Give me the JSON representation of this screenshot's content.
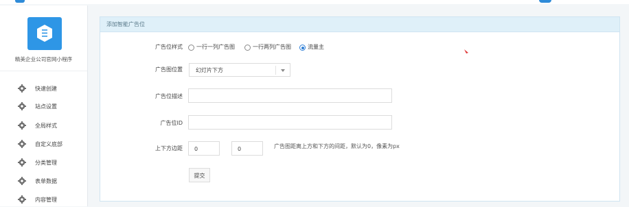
{
  "colors": {
    "accent": "#2e96e6",
    "panel_header_bg": "#dff0f9",
    "radio_checked": "#2f7fd6"
  },
  "sidebar": {
    "logo_icon": "hexagon-logo-icon",
    "app_name": "精美企业公司官网小程序",
    "items": [
      {
        "label": "快速创建",
        "icon": "gear-icon"
      },
      {
        "label": "站点设置",
        "icon": "gear-icon"
      },
      {
        "label": "全局样式",
        "icon": "gear-icon"
      },
      {
        "label": "自定义底部",
        "icon": "gear-icon"
      },
      {
        "label": "分类管理",
        "icon": "gear-icon"
      },
      {
        "label": "表单数据",
        "icon": "gear-icon"
      },
      {
        "label": "内容管理",
        "icon": "gear-icon"
      }
    ]
  },
  "panel": {
    "title": "添加智能广告位"
  },
  "form": {
    "style_label": "广告位样式",
    "style_options": [
      {
        "label": "一行一列广告图",
        "checked": false
      },
      {
        "label": "一行两列广告图",
        "checked": false
      },
      {
        "label": "流量主",
        "checked": true
      }
    ],
    "position_label": "广告图位置",
    "position_value": "幻灯片下方",
    "description_label": "广告位描述",
    "description_value": "",
    "adid_label": "广告位ID",
    "adid_value": "",
    "margin_label": "上下方边距",
    "margin_top_value": "0",
    "margin_bottom_value": "0",
    "margin_hint": "广告图距离上方和下方的间距，默认为0，像素为px",
    "submit_label": "提交"
  }
}
